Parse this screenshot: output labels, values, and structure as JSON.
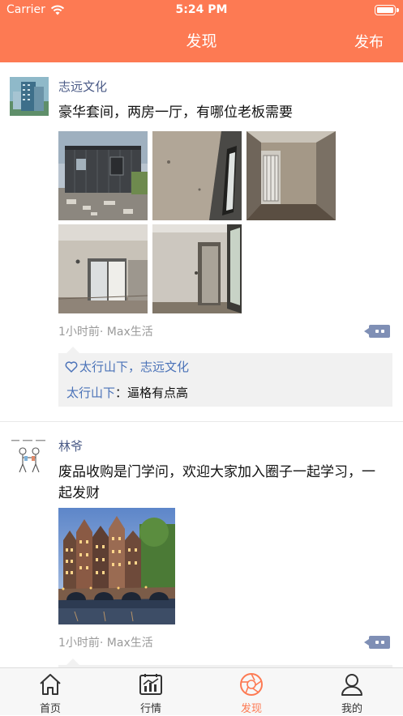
{
  "status_bar": {
    "carrier": "Carrier",
    "time": "5:24 PM"
  },
  "nav": {
    "title": "发现",
    "publish": "发布"
  },
  "posts": [
    {
      "username": "志远文化",
      "text": "豪华套间，两房一厅，有哪位老板需要",
      "meta": "1小时前· Max生活",
      "likes_by": "太行山下，志远文化",
      "comment_author": "太行山下",
      "comment_sep": "：",
      "comment_text": "逼格有点高"
    },
    {
      "username": "林爷",
      "text": "废品收购是门学问，欢迎大家加入圈子一起学习，一起发财",
      "meta": "1小时前· Max生活"
    }
  ],
  "tabs": [
    {
      "label": "首页",
      "icon": "home-icon"
    },
    {
      "label": "行情",
      "icon": "market-chart-icon"
    },
    {
      "label": "发现",
      "icon": "discover-aperture-icon",
      "active": true
    },
    {
      "label": "我的",
      "icon": "profile-person-icon"
    }
  ],
  "colors": {
    "accent": "#fd7a53",
    "name": "#4a5a86",
    "link": "#4a72b8",
    "meta": "#9a9a9a"
  }
}
